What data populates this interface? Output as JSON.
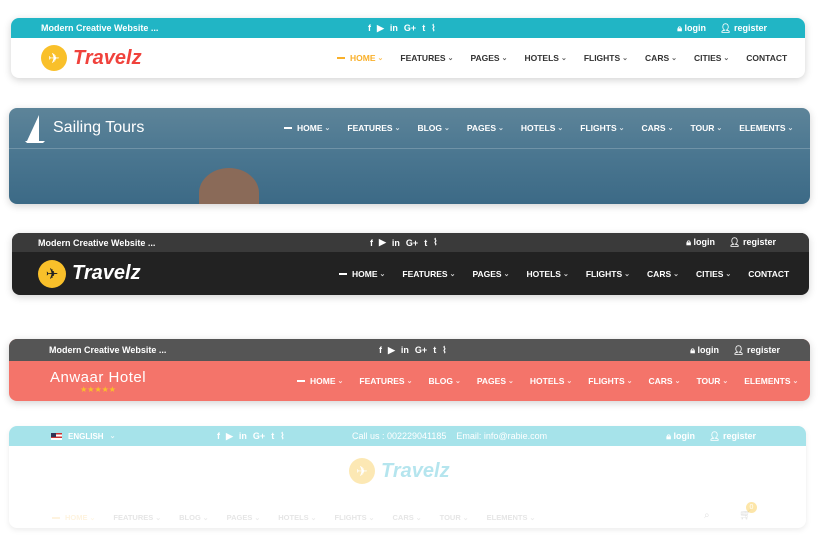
{
  "header1": {
    "tagline": "Modern Creative Website ...",
    "social_icons": [
      "facebook-icon",
      "youtube-icon",
      "linkedin-icon",
      "googleplus-icon",
      "twitter-icon",
      "rss-icon"
    ],
    "social_glyphs": [
      "f",
      "▶",
      "in",
      "G+",
      "t",
      "⌇"
    ],
    "login": "login",
    "register": "register",
    "brand": "Travelz",
    "menu": [
      "HOME",
      "FEATURES",
      "PAGES",
      "HOTELS",
      "FLIGHTS",
      "CARS",
      "CITIES",
      "CONTACT"
    ],
    "colors": {
      "topbar": "#21b5c5",
      "accent": "#28b8c8",
      "brand_blue": "#2fb6d1",
      "brand_red": "#f0423c",
      "logo_circle": "#f9c02a"
    }
  },
  "header2": {
    "brand": "Sailing Tours",
    "menu": [
      "HOME",
      "FEATURES",
      "BLOG",
      "PAGES",
      "HOTELS",
      "FLIGHTS",
      "CARS",
      "TOUR",
      "ELEMENTS"
    ]
  },
  "header3": {
    "tagline": "Modern Creative Website ...",
    "login": "login",
    "register": "register",
    "brand": "Travelz",
    "menu": [
      "HOME",
      "FEATURES",
      "PAGES",
      "HOTELS",
      "FLIGHTS",
      "CARS",
      "CITIES",
      "CONTACT"
    ],
    "colors": {
      "topbar": "#3a3a3a",
      "navbar": "#222222"
    }
  },
  "header4": {
    "tagline": "Modern Creative Website ...",
    "login": "login",
    "register": "register",
    "brand": "Anwaar Hotel",
    "stars": "★★★★★",
    "menu": [
      "HOME",
      "FEATURES",
      "BLOG",
      "PAGES",
      "HOTELS",
      "FLIGHTS",
      "CARS",
      "TOUR",
      "ELEMENTS"
    ],
    "colors": {
      "topbar": "#555555",
      "navbar": "#f4746a",
      "stars": "#f9c02a"
    }
  },
  "header5": {
    "language": "ENGLISH",
    "phone": "Call us : 002229041185",
    "email": "Email: info@rabie.com",
    "login": "login",
    "register": "register",
    "brand": "Travelz",
    "menu": [
      "HOME",
      "FEATURES",
      "BLOG",
      "PAGES",
      "HOTELS",
      "FLIGHTS",
      "CARS",
      "TOUR",
      "ELEMENTS"
    ],
    "cart_count": "0",
    "colors": {
      "topbar": "#a6e3ea"
    }
  }
}
